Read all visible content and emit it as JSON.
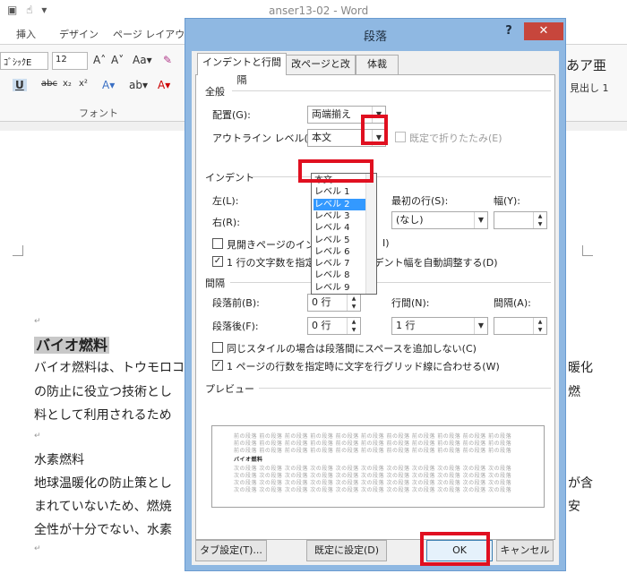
{
  "word": {
    "title": "anser13-02 - Word",
    "tabs": [
      "挿入",
      "デザイン",
      "ページ レイアウト"
    ],
    "font_name": "ｺﾞｼｯｸE",
    "font_size": "12",
    "font_group_label": "フォント",
    "styles_sample": "あア亜",
    "styles_label": "見出し 1",
    "heading": "バイオ燃料",
    "lines": [
      "バイオ燃料は、トウモロコ",
      "の防止に役立つ技術とし",
      "料として利用されるため",
      "水素燃料",
      "地球温暖化の防止策とし",
      "まれていないため、燃焼",
      "全性が十分でない、水素"
    ],
    "right_fragments": [
      "暖化",
      "燃",
      "が含",
      "安"
    ]
  },
  "dialog": {
    "title": "段落",
    "help": "?",
    "close": "✕",
    "tabs": [
      "インデントと行間隔",
      "改ページと改行",
      "体裁"
    ],
    "general": {
      "label": "全般",
      "alignment_label": "配置(G):",
      "alignment_value": "両端揃え",
      "outline_label": "アウトライン レベル(O):",
      "outline_value": "本文",
      "collapse_label": "既定で折りたたみ(E)"
    },
    "outline_options": [
      "本文",
      "レベル 1",
      "レベル 2",
      "レベル 3",
      "レベル 4",
      "レベル 5",
      "レベル 6",
      "レベル 7",
      "レベル 8",
      "レベル 9"
    ],
    "outline_selected_index": 2,
    "indent": {
      "label": "インデント",
      "left_label": "左(L):",
      "right_label": "右(R):",
      "first_line_label": "最初の行(S):",
      "first_line_value": "(なし)",
      "width_label": "幅(Y):",
      "mirror_label": "見開きページのインデ",
      "mirror_tail": "I)",
      "auto_adjust_label": "1 行の文字数を指定時に右のインデント幅を自動調整する(D)"
    },
    "spacing": {
      "label": "間隔",
      "before_label": "段落前(B):",
      "before_value": "0 行",
      "after_label": "段落後(F):",
      "after_value": "0 行",
      "line_spacing_label": "行間(N):",
      "line_spacing_value": "1 行",
      "at_label": "間隔(A):",
      "no_space_label": "同じスタイルの場合は段落間にスペースを追加しない(C)",
      "grid_label": "1 ページの行数を指定時に文字を行グリッド線に合わせる(W)"
    },
    "preview": {
      "label": "プレビュー",
      "prev_text": "前の段落 前の段落 前の段落 前の段落 前の段落 前の段落 前の段落 前の段落 前の段落 前の段落 前の段落",
      "current_text": "バイオ燃料",
      "next_text": "次の段落 次の段落 次の段落 次の段落 次の段落 次の段落 次の段落 次の段落 次の段落 次の段落 次の段落"
    },
    "buttons": {
      "tabs": "タブ設定(T)...",
      "default": "既定に設定(D)",
      "ok": "OK",
      "cancel": "キャンセル"
    }
  },
  "colors": {
    "dialog_frame": "#8fb8e2",
    "close_button": "#c7463c",
    "selection": "#3399ff",
    "highlight": "#e01020"
  }
}
